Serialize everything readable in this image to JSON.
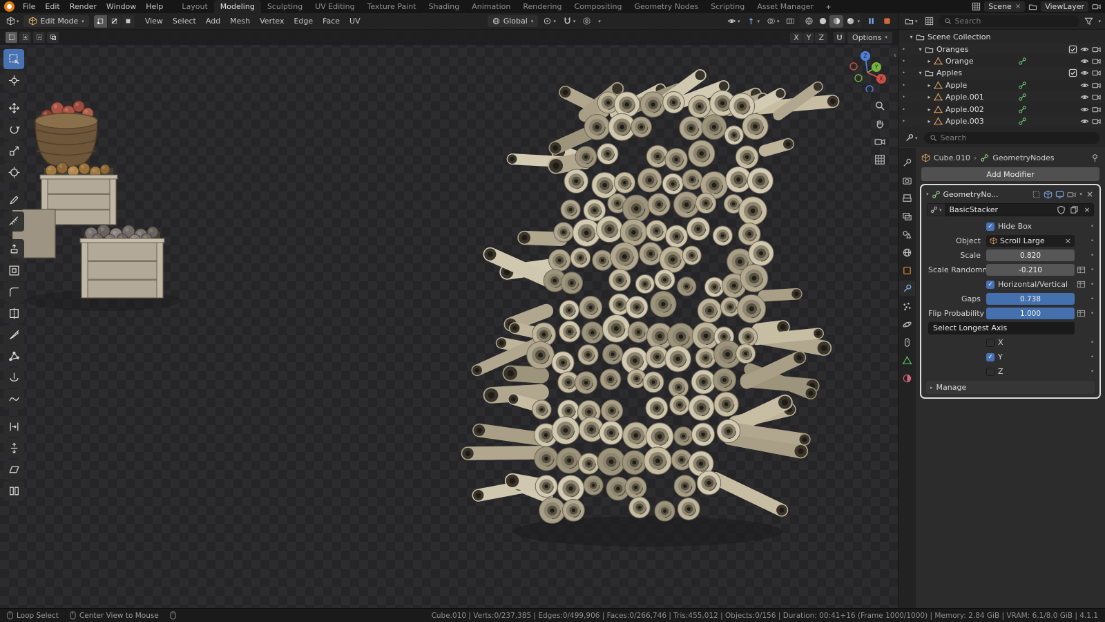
{
  "topbar": {
    "menus": [
      "File",
      "Edit",
      "Render",
      "Window",
      "Help"
    ],
    "workspace_tabs": [
      "Layout",
      "Modeling",
      "Sculpting",
      "UV Editing",
      "Texture Paint",
      "Shading",
      "Animation",
      "Rendering",
      "Compositing",
      "Geometry Nodes",
      "Scripting",
      "Asset Manager"
    ],
    "active_tab": "Modeling",
    "new_workspace_button": "+",
    "scene_name": "Scene",
    "viewlayer_name": "ViewLayer"
  },
  "viewport_header": {
    "mode_selector": "Edit Mode",
    "menus": [
      "View",
      "Select",
      "Add",
      "Mesh",
      "Vertex",
      "Edge",
      "Face",
      "UV"
    ],
    "transform_orientation": "Global",
    "mirror_axes": [
      "X",
      "Y",
      "Z"
    ],
    "options_button": "Options"
  },
  "left_toolbar": {
    "tools": [
      {
        "name": "tweak-select",
        "active": true
      },
      {
        "name": "cursor"
      },
      {
        "name": "move",
        "group": true
      },
      {
        "name": "rotate"
      },
      {
        "name": "scale"
      },
      {
        "name": "transform"
      },
      {
        "name": "annotate",
        "group": true
      },
      {
        "name": "measure"
      },
      {
        "name": "extrude-region",
        "group": true
      },
      {
        "name": "inset-faces"
      },
      {
        "name": "bevel"
      },
      {
        "name": "loop-cut"
      },
      {
        "name": "knife"
      },
      {
        "name": "poly-build"
      },
      {
        "name": "spin"
      },
      {
        "name": "smooth"
      },
      {
        "name": "edge-slide",
        "group": true
      },
      {
        "name": "shrink-fatten"
      },
      {
        "name": "shear"
      },
      {
        "name": "rip-region"
      }
    ]
  },
  "viewport": {
    "gizmo_axes": [
      "X",
      "Y",
      "Z"
    ]
  },
  "outliner": {
    "search_placeholder": "Search",
    "rows": [
      {
        "label": "Scene Collection",
        "depth": 0,
        "icon": "collection",
        "expand": "open",
        "extras": [],
        "dot": false
      },
      {
        "label": "Oranges",
        "depth": 1,
        "icon": "collection",
        "expand": "open",
        "extras": [
          "checkbox",
          "eye",
          "camera"
        ],
        "dot": true
      },
      {
        "label": "Orange",
        "depth": 2,
        "icon": "mesh",
        "expand": "closed",
        "extras": [
          "nodes",
          "eye",
          "camera"
        ],
        "dot": true
      },
      {
        "label": "Apples",
        "depth": 1,
        "icon": "collection",
        "expand": "open",
        "extras": [
          "checkbox",
          "eye",
          "camera"
        ],
        "dot": true
      },
      {
        "label": "Apple",
        "depth": 2,
        "icon": "mesh",
        "expand": "closed",
        "extras": [
          "nodes",
          "eye",
          "camera"
        ],
        "dot": true
      },
      {
        "label": "Apple.001",
        "depth": 2,
        "icon": "mesh",
        "expand": "closed",
        "extras": [
          "nodes",
          "eye",
          "camera"
        ],
        "dot": true
      },
      {
        "label": "Apple.002",
        "depth": 2,
        "icon": "mesh",
        "expand": "closed",
        "extras": [
          "nodes",
          "eye",
          "camera"
        ],
        "dot": true
      },
      {
        "label": "Apple.003",
        "depth": 2,
        "icon": "mesh",
        "expand": "closed",
        "extras": [
          "nodes",
          "eye",
          "camera"
        ],
        "dot": true
      }
    ]
  },
  "properties": {
    "search_placeholder": "Search",
    "breadcrumb": {
      "object": "Cube.010",
      "separator": "›",
      "modifier": "GeometryNodes"
    },
    "add_modifier_button": "Add Modifier",
    "tabs": [
      "tool",
      "render",
      "output",
      "view-layer",
      "scene",
      "world",
      "object",
      "modifiers",
      "particles",
      "physics",
      "constraints",
      "object-data",
      "material"
    ],
    "active_tab": "modifiers",
    "modifier": {
      "name": "GeometryNo...",
      "node_group": "BasicStacker",
      "rows": {
        "hide_box": {
          "label": "Hide Box",
          "checked": true
        },
        "object": {
          "label": "Object",
          "value": "Scroll Large"
        },
        "scale": {
          "label": "Scale",
          "value": "0.820"
        },
        "scale_randomness": {
          "label": "Scale Randomne...",
          "value": "-0.210"
        },
        "horizontal_vertical": {
          "label": "Horizontal/Vertical",
          "checked": true
        },
        "gaps": {
          "label": "Gaps",
          "value": "0.738"
        },
        "flip_probability": {
          "label": "Flip Probability",
          "value": "1.000"
        },
        "select_longest_axis": {
          "label": "Select Longest Axis"
        },
        "axis_x": {
          "label": "X",
          "checked": false
        },
        "axis_y": {
          "label": "Y",
          "checked": true
        },
        "axis_z": {
          "label": "Z",
          "checked": false
        }
      },
      "manage_section": "Manage"
    }
  },
  "statusbar": {
    "hints": [
      "Loop Select",
      "Center View to Mouse"
    ],
    "stats": "Cube.010 | Verts:0/237,385 | Edges:0/499,906 | Faces:0/266,746 | Tris:455,012 | Objects:0/156 | Duration: 00:41+16 (Frame 1000/1000) | Memory: 2.84 GiB | VRAM: 6.1/8.0 GiB | 4.1.1"
  },
  "colors": {
    "accent": "#4772b3",
    "keyed_field": "#4470ad",
    "axis_x": "#cc4f44",
    "axis_y": "#77b33f",
    "axis_z": "#4f7fd9"
  }
}
